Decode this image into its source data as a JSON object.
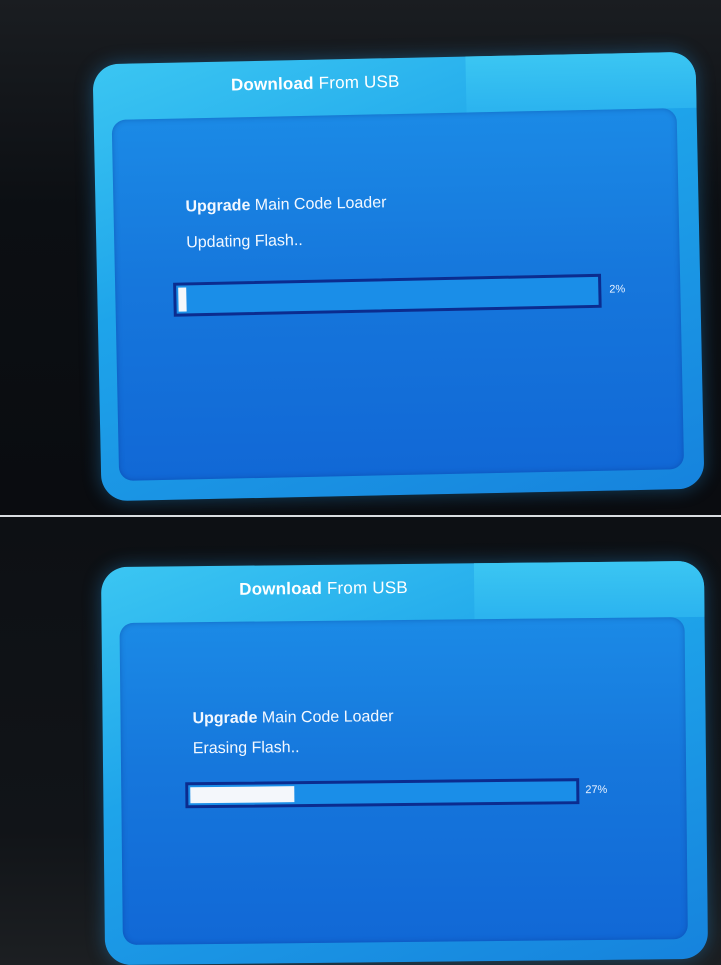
{
  "screens": [
    {
      "title_bold": "Download",
      "title_rest": " From USB",
      "line1_bold": "Upgrade",
      "line1_rest": " Main Code Loader",
      "status": "Updating Flash..",
      "progress_label": "2%",
      "progress_value": 0.02
    },
    {
      "title_bold": "Download",
      "title_rest": " From USB",
      "line1_bold": "Upgrade",
      "line1_rest": " Main Code Loader",
      "status": "Erasing Flash..",
      "progress_label": "27%",
      "progress_value": 0.27
    }
  ],
  "colors": {
    "panel_light": "#3bc6f2",
    "panel_dark": "#1168d6",
    "bar_border": "#0b2c8f",
    "bar_fill": "#f4f7fb"
  }
}
